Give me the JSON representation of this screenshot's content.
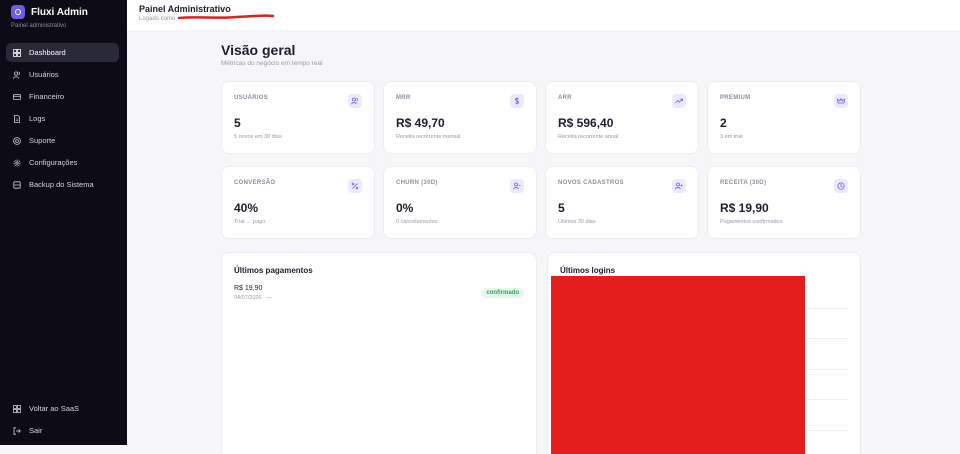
{
  "app": {
    "name": "Fluxi Admin",
    "subtitle": "Painel administrativo"
  },
  "sidebar": {
    "items": [
      {
        "label": "Dashboard",
        "icon": "grid-icon",
        "active": true
      },
      {
        "label": "Usuários",
        "icon": "users-icon"
      },
      {
        "label": "Financeiro",
        "icon": "credit-card-icon"
      },
      {
        "label": "Logs",
        "icon": "file-icon"
      },
      {
        "label": "Suporte",
        "icon": "lifebuoy-icon"
      },
      {
        "label": "Configurações",
        "icon": "gear-icon"
      },
      {
        "label": "Backup do Sistema",
        "icon": "database-icon"
      }
    ],
    "bottom": [
      {
        "label": "Voltar ao SaaS",
        "icon": "grid-icon"
      },
      {
        "label": "Sair",
        "icon": "logout-icon"
      }
    ]
  },
  "header": {
    "title": "Painel Administrativo",
    "subtitle": "Logado como"
  },
  "main": {
    "title": "Visão geral",
    "subtitle": "Métricas do negócio em tempo real",
    "metrics": [
      {
        "label": "USUÁRIOS",
        "value": "5",
        "sub": "5 novos em 30 dias",
        "icon": "users-icon"
      },
      {
        "label": "MRR",
        "value": "R$ 49,70",
        "sub": "Receita recorrente mensal",
        "icon": "dollar-icon"
      },
      {
        "label": "ARR",
        "value": "R$ 596,40",
        "sub": "Receita recorrente anual",
        "icon": "trending-up-icon"
      },
      {
        "label": "PREMIUM",
        "value": "2",
        "sub": "3 em trial",
        "icon": "crown-icon"
      },
      {
        "label": "CONVERSÃO",
        "value": "40%",
        "sub": "Trial → pago",
        "icon": "percent-icon"
      },
      {
        "label": "CHURN (30D)",
        "value": "0%",
        "sub": "0 cancelamentos",
        "icon": "user-minus-icon"
      },
      {
        "label": "NOVOS CADASTROS",
        "value": "5",
        "sub": "Últimos 30 dias",
        "icon": "user-plus-icon"
      },
      {
        "label": "RECEITA (30D)",
        "value": "R$ 19,90",
        "sub": "Pagamentos confirmados",
        "icon": "clock-icon"
      }
    ],
    "payments": {
      "title": "Últimos pagamentos",
      "items": [
        {
          "amount": "R$ 19,90",
          "date": "04/07/2026 · —",
          "status": "confirmado"
        }
      ]
    },
    "logins": {
      "title": "Últimos logins"
    }
  },
  "colors": {
    "accent": "#6d5ce8",
    "sidebar_bg": "#0d0c16",
    "success": "#2fa45a",
    "redaction": "#e41d1d"
  }
}
